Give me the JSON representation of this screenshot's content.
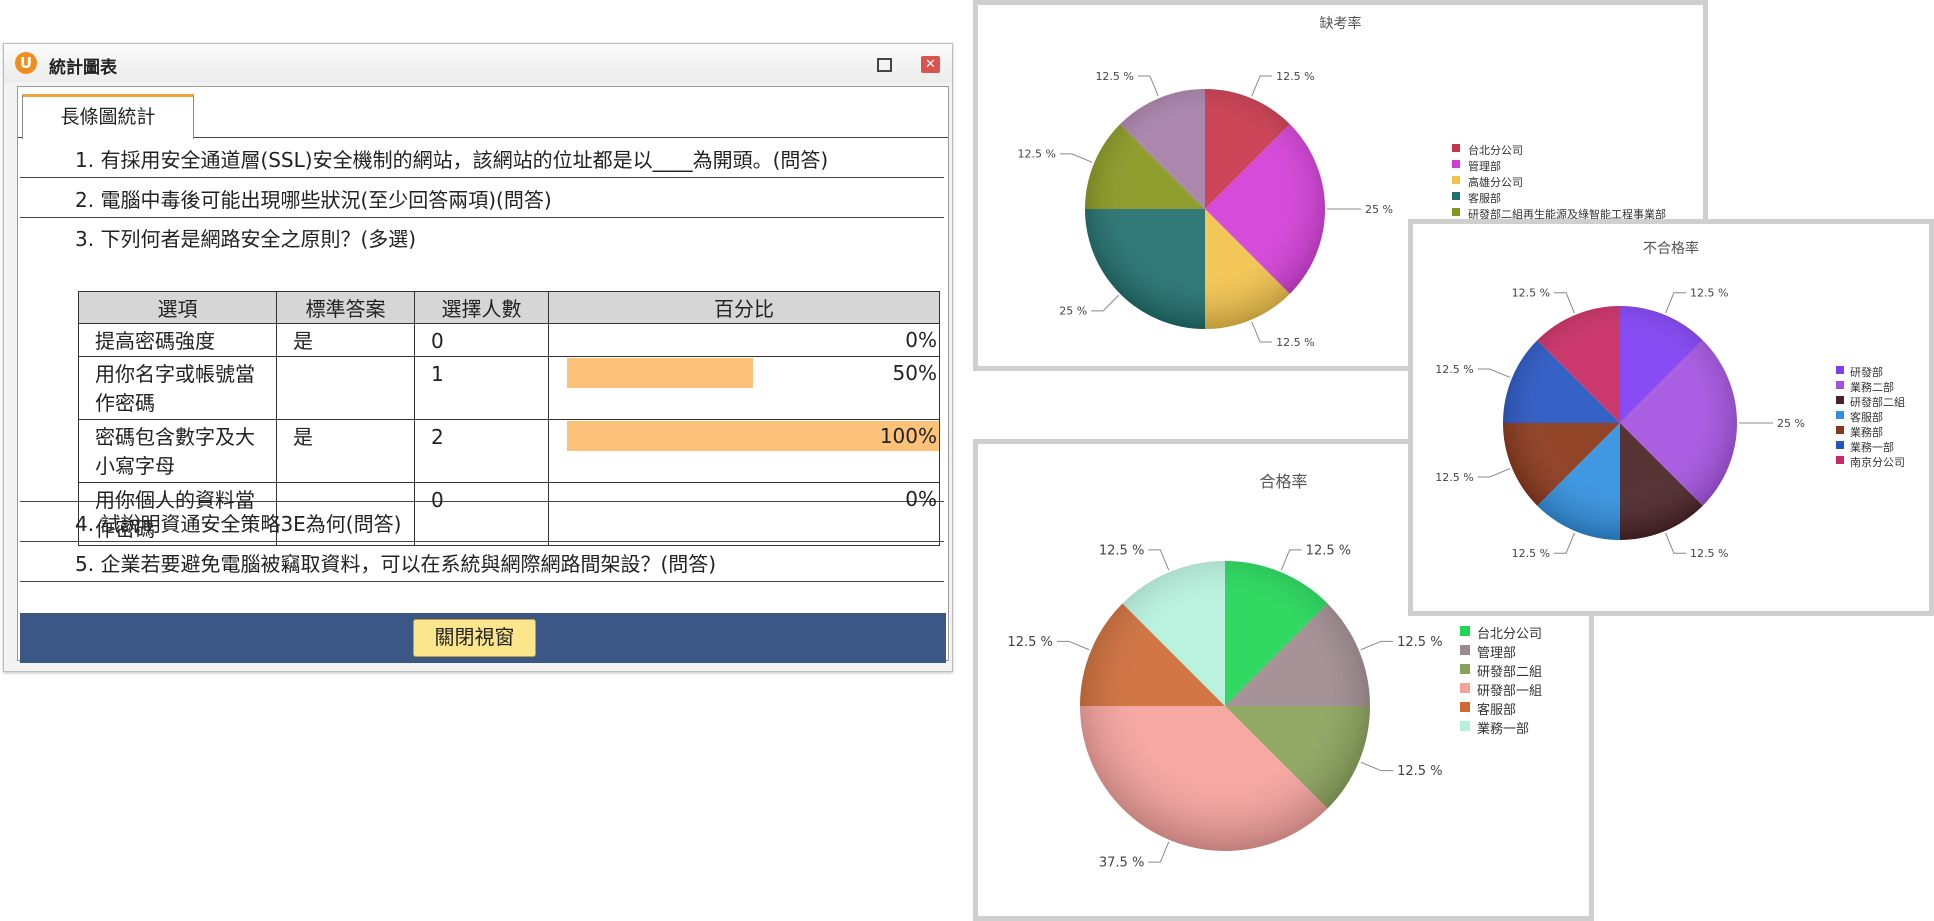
{
  "window": {
    "title": "統計圖表",
    "tab": "長條圖統計",
    "questions": [
      "1. 有採用安全通道層(SSL)安全機制的網站，該網站的位址都是以____為開頭。(問答)",
      "2. 電腦中毒後可能出現哪些狀況(至少回答兩項)(問答)",
      "3. 下列何者是網路安全之原則？(多選)",
      "4. 試說明資通安全策略3E為何(問答)",
      "5. 企業若要避免電腦被竊取資料，可以在系統與網際網路間架設？(問答)"
    ],
    "table": {
      "headers": [
        "選項",
        "標準答案",
        "選擇人數",
        "百分比"
      ],
      "rows": [
        {
          "option": "提高密碼強度",
          "answer": "是",
          "count": "0",
          "percent": "0%",
          "fraction": 0
        },
        {
          "option": "用你名字或帳號當作密碼",
          "answer": "",
          "count": "1",
          "percent": "50%",
          "fraction": 0.5
        },
        {
          "option": "密碼包含數字及大小寫字母",
          "answer": "是",
          "count": "2",
          "percent": "100%",
          "fraction": 1.0
        },
        {
          "option": "用你個人的資料當作密碼",
          "answer": "",
          "count": "0",
          "percent": "0%",
          "fraction": 0
        }
      ]
    },
    "close_button": "關閉視窗",
    "colors": {
      "bar": "#fcc27a",
      "footer": "#3b5785",
      "tab_accent": "#f2a43c"
    }
  },
  "chart_data": [
    {
      "type": "pie",
      "title": "缺考率",
      "categories": [
        "台北分公司",
        "管理部",
        "高雄分公司",
        "客服部",
        "研發部二組再生能源及綠智能工程事業部"
      ],
      "slices": [
        {
          "category": "台北分公司",
          "value": 12.5,
          "color": "#c8354a"
        },
        {
          "category": "管理部",
          "value": 25,
          "color": "#d23bd6"
        },
        {
          "category": "高雄分公司",
          "value": 12.5,
          "color": "#f3c34a"
        },
        {
          "category": "客服部",
          "value": 25,
          "color": "#1f6f6c"
        },
        {
          "category": "研發部二組再生能源及綠智能工程事業部",
          "value": 12.5,
          "color": "#86961d"
        },
        {
          "category": "",
          "value": 12.5,
          "color": "#a57ea8"
        }
      ],
      "labels": [
        "12.5 %",
        "25 %",
        "12.5 %",
        "25 %",
        "12.5 %",
        "12.5 %"
      ]
    },
    {
      "type": "pie",
      "title": "合格率",
      "categories": [
        "台北分公司",
        "管理部",
        "研發部二組",
        "研發部一組",
        "客服部",
        "業務一部"
      ],
      "slices": [
        {
          "category": "台北分公司",
          "value": 12.5,
          "color": "#1fd655"
        },
        {
          "category": "管理部",
          "value": 12.5,
          "color": "#9e8a8e"
        },
        {
          "category": "研發部二組",
          "value": 12.5,
          "color": "#8aa35a"
        },
        {
          "category": "研發部一組",
          "value": 37.5,
          "color": "#f5a09b"
        },
        {
          "category": "客服部",
          "value": 12.5,
          "color": "#cd6a35"
        },
        {
          "category": "業務一部",
          "value": 12.5,
          "color": "#b5f0dc"
        }
      ],
      "labels": [
        "12.5 %",
        "12.5 %",
        "12.5 %",
        "37.5 %",
        "12.5 %",
        "12.5 %"
      ]
    },
    {
      "type": "pie",
      "title": "不合格率",
      "categories": [
        "研發部",
        "業務二部",
        "研發部二組",
        "客服部",
        "業務部",
        "業務一部",
        "南京分公司"
      ],
      "slices": [
        {
          "category": "研發部",
          "value": 12.5,
          "color": "#7d3df2"
        },
        {
          "category": "業務二部",
          "value": 25,
          "color": "#a350e0"
        },
        {
          "category": "研發部二組",
          "value": 12.5,
          "color": "#4a2226"
        },
        {
          "category": "客服部",
          "value": 12.5,
          "color": "#2f8fe0"
        },
        {
          "category": "業務部",
          "value": 12.5,
          "color": "#8a3518"
        },
        {
          "category": "業務一部",
          "value": 12.5,
          "color": "#2553c2"
        },
        {
          "category": "南京分公司",
          "value": 12.5,
          "color": "#c8285f"
        }
      ],
      "labels": [
        "12.5 %",
        "25 %",
        "12.5 %",
        "12.5 %",
        "12.5 %",
        "12.5 %",
        "12.5 %"
      ]
    }
  ]
}
